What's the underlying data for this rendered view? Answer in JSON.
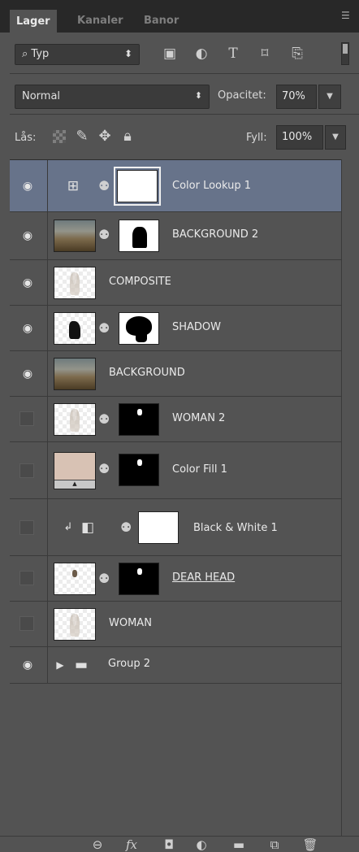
{
  "tabs": [
    "Lager",
    "Kanaler",
    "Banor"
  ],
  "filter": {
    "label": "Typ"
  },
  "blend": {
    "mode": "Normal",
    "opacity_label": "Opacitet:",
    "opacity_value": "70%"
  },
  "lock": {
    "label": "Lås:",
    "fill_label": "Fyll:",
    "fill_value": "100%"
  },
  "layers": [
    {
      "name": "Color Lookup 1",
      "visible": true,
      "selected": true,
      "kind": "adjustment",
      "icon": "grid-icon"
    },
    {
      "name": "BACKGROUND 2",
      "visible": true,
      "kind": "image-mask"
    },
    {
      "name": "COMPOSITE",
      "visible": true,
      "kind": "image"
    },
    {
      "name": "SHADOW",
      "visible": true,
      "kind": "image-mask"
    },
    {
      "name": "BACKGROUND",
      "visible": true,
      "kind": "image"
    },
    {
      "name": "WOMAN 2",
      "visible": false,
      "kind": "image-mask"
    },
    {
      "name": "Color Fill 1",
      "visible": false,
      "kind": "fill-mask"
    },
    {
      "name": "Black & White 1",
      "visible": false,
      "kind": "adjustment-clipped",
      "icon": "half-square-icon"
    },
    {
      "name": "DEAR HEAD",
      "visible": false,
      "kind": "image-mask"
    },
    {
      "name": "WOMAN",
      "visible": false,
      "kind": "image"
    },
    {
      "name": "Group 2",
      "visible": true,
      "kind": "group"
    }
  ],
  "footer_icons": [
    "link-icon",
    "fx-icon",
    "add-mask-icon",
    "adjustment-layer-icon",
    "group-folder-icon",
    "new-layer-icon",
    "trash-icon"
  ],
  "colors": {
    "panel": "#535353",
    "selected_row": "#67738a",
    "tabbar": "#282828",
    "fill_swatch": "#d8c2b4"
  }
}
